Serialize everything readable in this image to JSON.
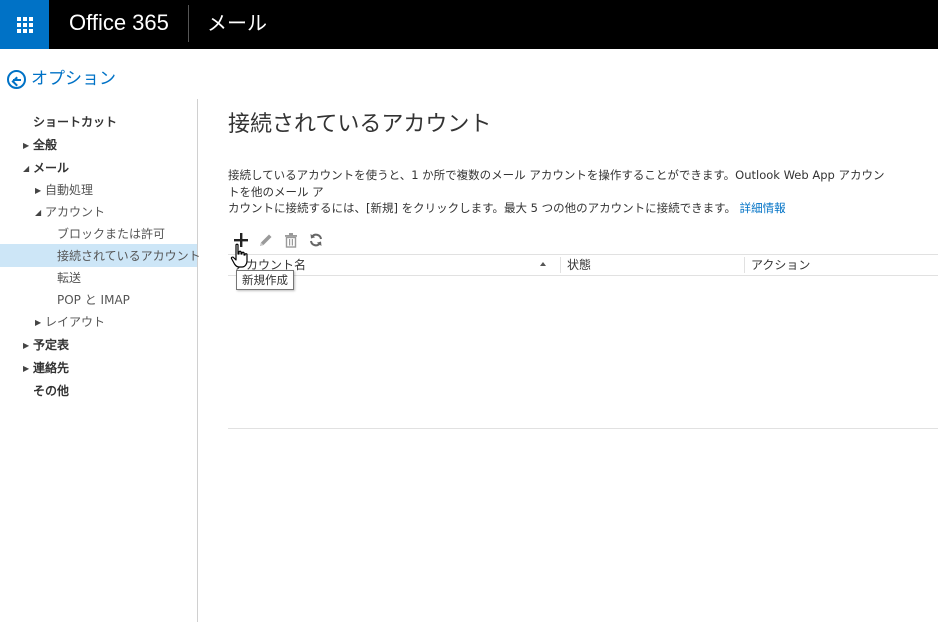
{
  "topbar": {
    "brand": "Office 365",
    "app_name": "メール",
    "brand_color": "#0072c6"
  },
  "back": {
    "label": "オプション",
    "icon": "back-arrow-circle-icon"
  },
  "sidebar": {
    "items": [
      {
        "label": "ショートカット",
        "level": 0,
        "caret": "",
        "bold": true
      },
      {
        "label": "全般",
        "level": 0,
        "caret": "right",
        "bold": true
      },
      {
        "label": "メール",
        "level": 0,
        "caret": "down",
        "bold": true
      },
      {
        "label": "自動処理",
        "level": 1,
        "caret": "right",
        "bold": false
      },
      {
        "label": "アカウント",
        "level": 1,
        "caret": "down",
        "bold": false
      },
      {
        "label": "ブロックまたは許可",
        "level": 2,
        "caret": "",
        "bold": false
      },
      {
        "label": "接続されているアカウント",
        "level": 2,
        "caret": "",
        "bold": false,
        "selected": true
      },
      {
        "label": "転送",
        "level": 2,
        "caret": "",
        "bold": false
      },
      {
        "label": "POP と IMAP",
        "level": 2,
        "caret": "",
        "bold": false
      },
      {
        "label": "レイアウト",
        "level": 1,
        "caret": "right",
        "bold": false
      },
      {
        "label": "予定表",
        "level": 0,
        "caret": "right",
        "bold": true
      },
      {
        "label": "連絡先",
        "level": 0,
        "caret": "right",
        "bold": true
      },
      {
        "label": "その他",
        "level": 0,
        "caret": "",
        "bold": true
      }
    ],
    "selected_color": "#cde6f7"
  },
  "main": {
    "title": "接続されているアカウント",
    "description_line1": "接続しているアカウントを使うと、1 か所で複数のメール アカウントを操作することができます。Outlook Web App アカウントを他のメール ア",
    "description_line2": "カウントに接続するには、[新規] をクリックします。最大 5 つの他のアカウントに接続できます。",
    "more_info_link": "詳細情報",
    "toolbar": {
      "new_icon": "plus-icon",
      "edit_icon": "pencil-icon",
      "delete_icon": "trash-icon",
      "refresh_icon": "refresh-icon"
    },
    "grid": {
      "columns": [
        "アカウント名",
        "状態",
        "アクション"
      ],
      "sorted_column": "アカウント名",
      "sort_direction": "ascending",
      "rows": []
    },
    "tooltip": "新規作成"
  }
}
